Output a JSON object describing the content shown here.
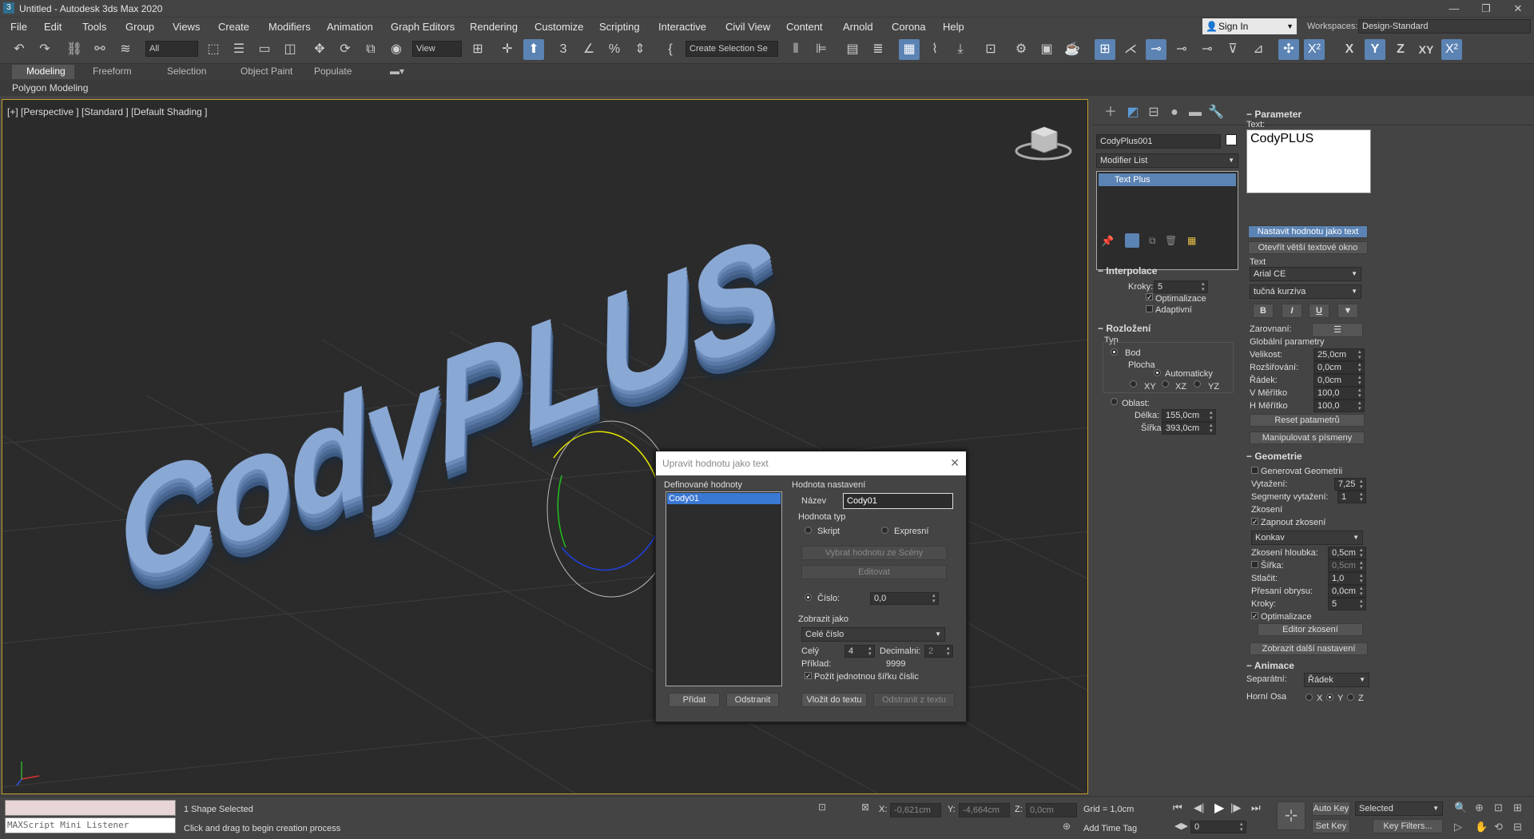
{
  "window": {
    "title": "Untitled - Autodesk 3ds Max 2020",
    "min": "—",
    "max": "❐",
    "close": "✕"
  },
  "menu": [
    "File",
    "Edit",
    "Tools",
    "Group",
    "Views",
    "Create",
    "Modifiers",
    "Animation",
    "Graph Editors",
    "Rendering",
    "Customize",
    "Scripting",
    "Interactive",
    "Civil View",
    "Content",
    "Arnold",
    "Corona",
    "Help"
  ],
  "signin": "Sign In",
  "workspaces_label": "Workspaces:",
  "workspace": "Design-Standard",
  "toolbar": {
    "filter": "All",
    "refcoord": "View",
    "selset": "Create Selection Se"
  },
  "ribbon": {
    "tabs": [
      "Modeling",
      "Freeform",
      "Selection",
      "Object Paint",
      "Populate"
    ],
    "sub": "Polygon Modeling"
  },
  "viewport": {
    "label": "[+] [Perspective ] [Standard ] [Default Shading ]",
    "text3d": "CodyPLUS"
  },
  "panel": {
    "object_name": "CodyPlus001",
    "modifier_list": "Modifier List",
    "stack_item": "Text Plus",
    "interp": {
      "title": "Interpolace",
      "steps_label": "Kroky:",
      "steps": "5",
      "optim": "Optimalizace",
      "adaptive": "Adaptivní"
    },
    "layout": {
      "title": "Rozložení",
      "type": "Typ",
      "point": "Bod",
      "plane": "Plocha",
      "auto": "Automaticky",
      "xy": "XY",
      "xz": "XZ",
      "yz": "YZ",
      "area": "Oblast:",
      "length_label": "Délka:",
      "length": "155,0cm",
      "width_label": "Šířka",
      "width": "393,0cm"
    },
    "param": {
      "title": "Parameter",
      "text_label": "Text:",
      "text": "CodyPLUS",
      "set_value": "Nastavit hodnotu jako text",
      "open_bigger": "Otevřít větší textové okno",
      "text_group": "Text",
      "font": "Arial CE",
      "style": "tučná kurzíva",
      "bold": "B",
      "italic": "I",
      "under": "U",
      "align": "Zarovnaní:",
      "global": "Globální parametry",
      "size_l": "Velikost:",
      "size": "25,0cm",
      "kern_l": "Rozšiřování:",
      "kern": "0,0cm",
      "lead_l": "Řádek:",
      "lead": "0,0cm",
      "vscale_l": "V Měřítko",
      "vscale": "100,0",
      "hscale_l": "H Měřítko",
      "hscale": "100,0",
      "reset": "Reset patametrů",
      "manip": "Manipulovat s písmeny"
    },
    "geom": {
      "title": "Geometrie",
      "gen": "Generovat Geometrii",
      "extr_l": "Vytažení:",
      "extr": "7,25",
      "segs_l": "Segmenty vytažení:",
      "segs": "1",
      "bevel": "Zkosení",
      "bevel_on": "Zapnout zkosení",
      "bevel_type": "Konkav",
      "bdepth_l": "Zkosení hloubka:",
      "bdepth": "0,5cm",
      "bwidth_l": "Šířka:",
      "bwidth": "0,5cm",
      "smooth_l": "Stlačit:",
      "smooth": "1,0",
      "overlap_l": "Přesaní obrysu:",
      "overlap": "0,0cm",
      "steps_l": "Kroky:",
      "steps": "5",
      "optim": "Optimalizace",
      "editor": "Editor zkosení",
      "more": "Zobrazit další nastavení"
    },
    "anim": {
      "title": "Animace",
      "sep_l": "Separátní:",
      "sep": "Řádek",
      "axis_l": "Horní Osa",
      "x": "X",
      "y": "Y",
      "z": "Z"
    }
  },
  "dialog": {
    "title": "Upravit hodnotu jako text",
    "defined": "Definované hodnoty",
    "item": "Cody01",
    "setting": "Hodnota nastavení",
    "name_l": "Název",
    "name": "Cody01",
    "type": "Hodnota typ",
    "script": "Skript",
    "expr": "Expresní",
    "pick": "Vybrat hodnotu ze Scény",
    "edit": "Editovat",
    "num_l": "Číslo:",
    "num": "0,0",
    "show_as": "Zobrazit jako",
    "format": "Celé číslo",
    "whole_l": "Celý",
    "whole": "4",
    "dec_l": "Decimalni:",
    "dec": "2",
    "ex_l": "Příklad:",
    "ex": "9999",
    "fixed": "Požít jednotnou šířku číslic",
    "add": "Přidat",
    "remove": "Odstranit",
    "insert": "Vložit do textu",
    "remove_text": "Odstranit z textu"
  },
  "status": {
    "listener": "MAXScript Mini Listener",
    "selected": "1 Shape Selected",
    "prompt": "Click and drag to begin creation process",
    "x_l": "X:",
    "x": "-0,621cm",
    "y_l": "Y:",
    "y": "-4,664cm",
    "z_l": "Z:",
    "z": "0,0cm",
    "grid": "Grid = 1,0cm",
    "autokey": "Auto Key",
    "setkey": "Set Key",
    "sel": "Selected",
    "keyfilters": "Key Filters...",
    "frame": "0",
    "addtime": "Add Time Tag"
  }
}
